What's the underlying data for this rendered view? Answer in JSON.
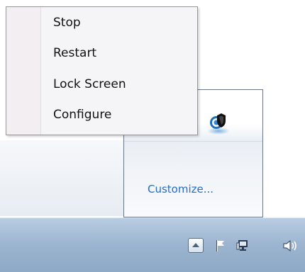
{
  "context_menu": {
    "items": [
      {
        "label": "Stop"
      },
      {
        "label": "Restart"
      },
      {
        "label": "Lock Screen"
      },
      {
        "label": "Configure"
      }
    ]
  },
  "tray_flyout": {
    "customize_label": "Customize...",
    "app_icon": "app-shield-icon"
  },
  "taskbar": {
    "tray_icons": [
      "show-hidden-icons-arrow",
      "action-center-flag-icon",
      "network-icon",
      "volume-icon"
    ]
  },
  "colors": {
    "link": "#1e6dd0",
    "taskbar": "#9bb4cf",
    "menu_bg": "#f5f5f7"
  }
}
